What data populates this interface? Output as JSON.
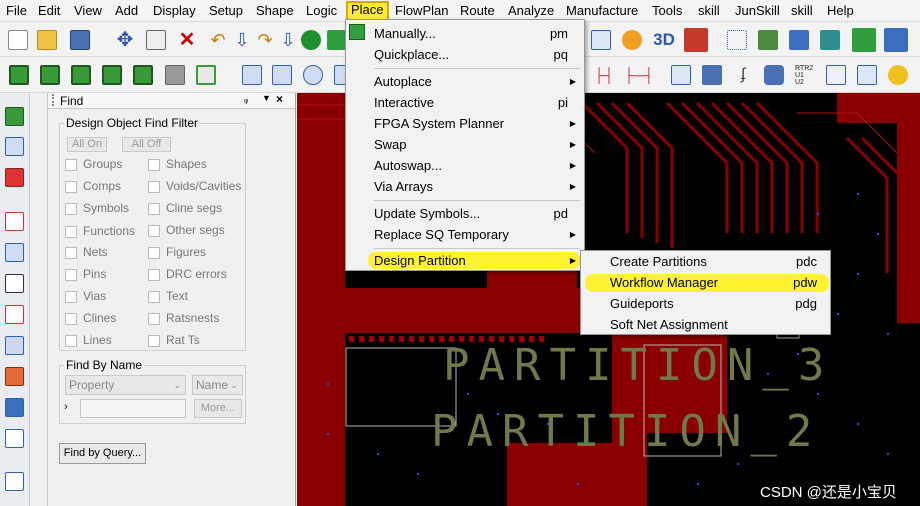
{
  "menubar": [
    "File",
    "Edit",
    "View",
    "Add",
    "Display",
    "Setup",
    "Shape",
    "Logic",
    "Place",
    "FlowPlan",
    "Route",
    "Analyze",
    "Manufacture",
    "Tools",
    "skill",
    "JunSkill",
    "skill",
    "Help"
  ],
  "find_panel": {
    "title": "Find",
    "pin": "↓ ×",
    "filter_group": "Design Object Find Filter",
    "all_on": "All On",
    "all_off": "All Off",
    "left_items": [
      "Groups",
      "Comps",
      "Symbols",
      "Functions",
      "Nets",
      "Pins",
      "Vias",
      "Clines",
      "Lines"
    ],
    "right_items": [
      "Shapes",
      "Voids/Cavities",
      "Cline segs",
      "Other segs",
      "Figures",
      "DRC errors",
      "Text",
      "Ratsnests",
      "Rat Ts"
    ],
    "find_by_name": "Find By Name",
    "property": "Property",
    "name": "Name",
    "more": "More...",
    "find_by_query": "Find by Query..."
  },
  "place_menu": [
    {
      "label": "Manually...",
      "acc": "pm"
    },
    {
      "label": "Quickplace...",
      "acc": "pq"
    },
    {
      "label": "Autoplace",
      "arrow": true
    },
    {
      "label": "Interactive",
      "acc": "pi"
    },
    {
      "label": "FPGA System Planner",
      "arrow": true
    },
    {
      "label": "Swap",
      "arrow": true
    },
    {
      "label": "Autoswap...",
      "arrow": true
    },
    {
      "label": "Via Arrays",
      "arrow": true
    },
    {
      "label": "Update Symbols...",
      "acc": "pd"
    },
    {
      "label": "Replace SQ Temporary",
      "arrow": true
    },
    {
      "label": "Design Partition",
      "arrow": true
    }
  ],
  "submenu": [
    {
      "label": "Create Partitions",
      "acc": "pdc"
    },
    {
      "label": "Workflow Manager",
      "acc": "pdw"
    },
    {
      "label": "Guideports",
      "acc": "pdg"
    },
    {
      "label": "Soft Net Assignment",
      "acc": ""
    }
  ],
  "canvas_text": [
    "PARTITION_3",
    "PARTITION_2"
  ],
  "watermark": "CSDN @还是小宝贝",
  "colors": {
    "highlight": "#fff230",
    "trace": "#8a0000",
    "via": "#3040ff",
    "partition_text": "#6f7a4a"
  }
}
